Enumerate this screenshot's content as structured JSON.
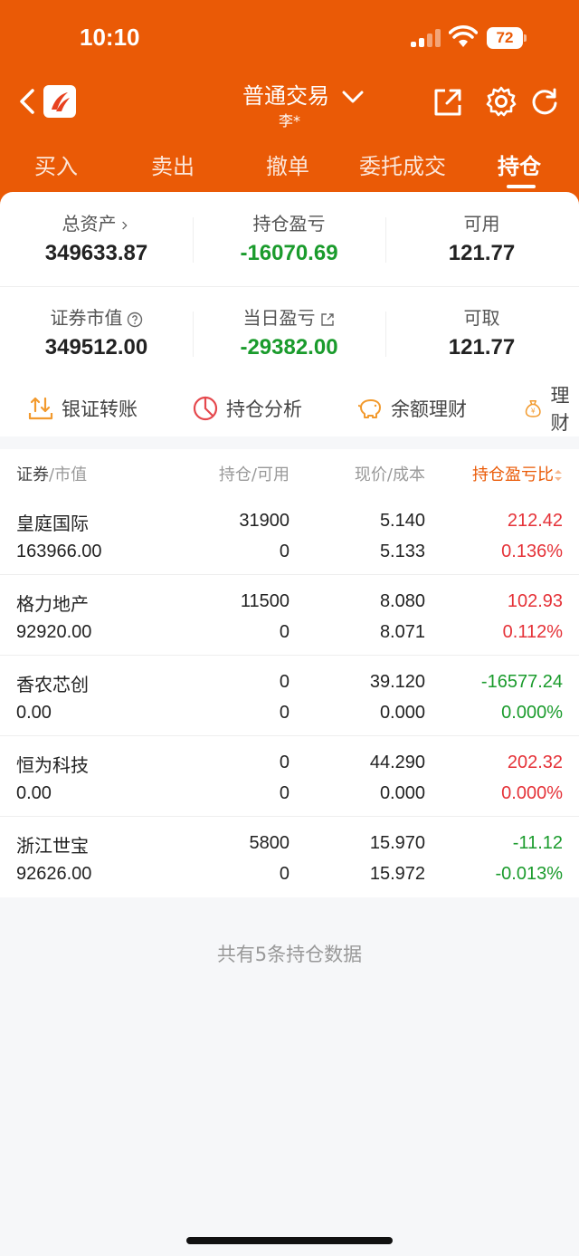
{
  "status_bar": {
    "time": "10:10",
    "battery": "72"
  },
  "header": {
    "title": "普通交易",
    "account": "李*"
  },
  "tabs": [
    {
      "label": "买入"
    },
    {
      "label": "卖出"
    },
    {
      "label": "撤单"
    },
    {
      "label": "委托成交"
    },
    {
      "label": "持仓"
    }
  ],
  "summary": {
    "total_assets_label": "总资产",
    "total_assets": "349633.87",
    "position_pl_label": "持仓盈亏",
    "position_pl": "-16070.69",
    "available_label": "可用",
    "available": "121.77",
    "market_value_label": "证券市值",
    "market_value": "349512.00",
    "daily_pl_label": "当日盈亏",
    "daily_pl": "-29382.00",
    "withdrawable_label": "可取",
    "withdrawable": "121.77"
  },
  "quick_actions": [
    {
      "label": "银证转账",
      "icon": "transfer-icon"
    },
    {
      "label": "持仓分析",
      "icon": "pie-chart-icon"
    },
    {
      "label": "余额理财",
      "icon": "piggy-bank-icon"
    },
    {
      "label": "理财",
      "icon": "money-bag-icon"
    }
  ],
  "table": {
    "headers": {
      "security": "证券",
      "market_value": "市值",
      "holding": "持仓",
      "available": "可用",
      "price": "现价",
      "cost": "成本",
      "pl_ratio": "持仓盈亏比"
    },
    "rows": [
      {
        "name": "皇庭国际",
        "market_value": "163966.00",
        "holding": "31900",
        "available": "0",
        "price": "5.140",
        "cost": "5.133",
        "pl": "212.42",
        "pl_pct": "0.136%",
        "trend": "up"
      },
      {
        "name": "格力地产",
        "market_value": "92920.00",
        "holding": "11500",
        "available": "0",
        "price": "8.080",
        "cost": "8.071",
        "pl": "102.93",
        "pl_pct": "0.112%",
        "trend": "up"
      },
      {
        "name": "香农芯创",
        "market_value": "0.00",
        "holding": "0",
        "available": "0",
        "price": "39.120",
        "cost": "0.000",
        "pl": "-16577.24",
        "pl_pct": "0.000%",
        "trend": "down"
      },
      {
        "name": "恒为科技",
        "market_value": "0.00",
        "holding": "0",
        "available": "0",
        "price": "44.290",
        "cost": "0.000",
        "pl": "202.32",
        "pl_pct": "0.000%",
        "trend": "up"
      },
      {
        "name": "浙江世宝",
        "market_value": "92626.00",
        "holding": "5800",
        "available": "0",
        "price": "15.970",
        "cost": "15.972",
        "pl": "-11.12",
        "pl_pct": "-0.013%",
        "trend": "down"
      }
    ]
  },
  "footer_note": "共有5条持仓数据",
  "colors": {
    "brand": "#ea5a06",
    "up": "#e53238",
    "down": "#1a9b2c"
  }
}
